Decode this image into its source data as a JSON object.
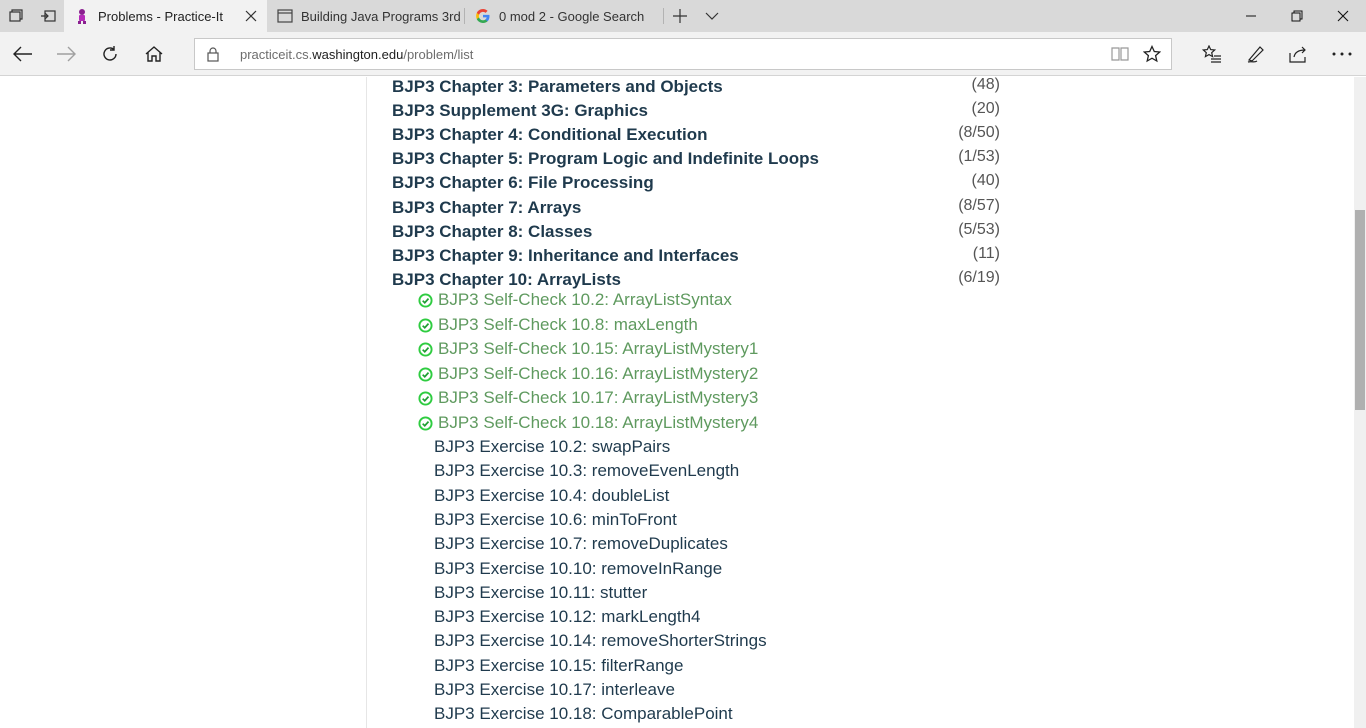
{
  "tabs": [
    {
      "title": "Problems - Practice-It",
      "favicon": "practice-it-logo-icon",
      "active": true
    },
    {
      "title": "Building Java Programs 3rd",
      "favicon": "page-icon",
      "active": false
    },
    {
      "title": "0 mod 2 - Google Search",
      "favicon": "google-g-icon",
      "active": false
    }
  ],
  "address_bar": {
    "url_prefix": "practiceit.cs.",
    "url_host": "washington.edu",
    "url_path": "/problem/list"
  },
  "chapters": [
    {
      "label": "BJP3 Chapter 3: Parameters and Objects",
      "count": "(48)"
    },
    {
      "label": "BJP3 Supplement 3G: Graphics",
      "count": "(20)"
    },
    {
      "label": "BJP3 Chapter 4: Conditional Execution",
      "count": "(8/50)"
    },
    {
      "label": "BJP3 Chapter 5: Program Logic and Indefinite Loops",
      "count": "(1/53)"
    },
    {
      "label": "BJP3 Chapter 6: File Processing",
      "count": "(40)"
    },
    {
      "label": "BJP3 Chapter 7: Arrays",
      "count": "(8/57)"
    },
    {
      "label": "BJP3 Chapter 8: Classes",
      "count": "(5/53)"
    },
    {
      "label": "BJP3 Chapter 9: Inheritance and Interfaces",
      "count": "(11)"
    },
    {
      "label": "BJP3 Chapter 10: ArrayLists",
      "count": "(6/19)"
    }
  ],
  "problems": [
    {
      "label": "BJP3 Self-Check 10.2: ArrayListSyntax",
      "solved": true
    },
    {
      "label": "BJP3 Self-Check 10.8: maxLength",
      "solved": true
    },
    {
      "label": "BJP3 Self-Check 10.15: ArrayListMystery1",
      "solved": true
    },
    {
      "label": "BJP3 Self-Check 10.16: ArrayListMystery2",
      "solved": true
    },
    {
      "label": "BJP3 Self-Check 10.17: ArrayListMystery3",
      "solved": true
    },
    {
      "label": "BJP3 Self-Check 10.18: ArrayListMystery4",
      "solved": true
    },
    {
      "label": "BJP3 Exercise 10.2: swapPairs",
      "solved": false
    },
    {
      "label": "BJP3 Exercise 10.3: removeEvenLength",
      "solved": false
    },
    {
      "label": "BJP3 Exercise 10.4: doubleList",
      "solved": false
    },
    {
      "label": "BJP3 Exercise 10.6: minToFront",
      "solved": false
    },
    {
      "label": "BJP3 Exercise 10.7: removeDuplicates",
      "solved": false
    },
    {
      "label": "BJP3 Exercise 10.10: removeInRange",
      "solved": false
    },
    {
      "label": "BJP3 Exercise 10.11: stutter",
      "solved": false
    },
    {
      "label": "BJP3 Exercise 10.12: markLength4",
      "solved": false
    },
    {
      "label": "BJP3 Exercise 10.14: removeShorterStrings",
      "solved": false
    },
    {
      "label": "BJP3 Exercise 10.15: filterRange",
      "solved": false
    },
    {
      "label": "BJP3 Exercise 10.17: interleave",
      "solved": false
    },
    {
      "label": "BJP3 Exercise 10.18: ComparablePoint",
      "solved": false
    }
  ],
  "colors": {
    "chapter_text": "#1f3a4d",
    "solved_text": "#5f9a5f",
    "check_green": "#2ecc40",
    "tabstrip_bg": "#d9d9d9"
  }
}
